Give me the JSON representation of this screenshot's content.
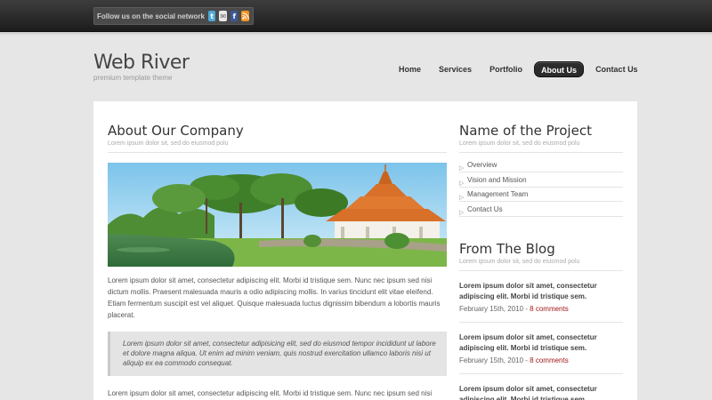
{
  "topbar": {
    "social_text": "Follow us on the social network",
    "icons": [
      "twitter-icon",
      "mail-icon",
      "facebook-icon",
      "rss-icon"
    ]
  },
  "logo": {
    "title": "Web River",
    "subtitle": "premium template theme"
  },
  "nav": {
    "items": [
      "Home",
      "Services",
      "Portfolio",
      "About Us",
      "Contact Us"
    ],
    "active": "About Us"
  },
  "main": {
    "title": "About Our Company",
    "subtitle": "Lorem ipsum dolor sit, sed do eiusmod polu",
    "paragraph1": "Lorem ipsum dolor sit amet, consectetur adipiscing elit. Morbi id tristique sem. Nunc nec ipsum sed nisi dictum mollis. Praesent malesuada mauris a odio adipiscing mollis. In varius tincidunt elit vitae eleifend. Etiam fermentum suscipit est vel aliquet. Quisque malesuada luctus dignissim bibendum a lobortis mauris placerat.",
    "quote": "Lorem ipsum dolor sit amet, consectetur adipisicing elit, sed do eiusmod tempor incididunt ut labore et dolore magna aliqua. Ut enim ad minim veniam, quis nostrud exercitation ullamco laboris nisi ut aliquip ex ea commodo consequat.",
    "paragraph2": "Lorem ipsum dolor sit amet, consectetur adipiscing elit. Morbi id tristique sem. Nunc nec ipsum sed nisi"
  },
  "sidebar": {
    "project_title": "Name of the Project",
    "project_subtitle": "Lorem ipsum dolor sit, sed do eiusmod polu",
    "menu": [
      "Overview",
      "Vision and Mission",
      "Management Team",
      "Contact Us"
    ],
    "blog_title": "From The Blog",
    "blog_subtitle": "Lorem ipsum dolor sit, sed do eiusmod polu",
    "posts": [
      {
        "title": "Lorem ipsum dolor sit amet, consectetur adipiscing elit. Morbi id tristique sem.",
        "date": "February 15th, 2010 - ",
        "comments": "8 comments"
      },
      {
        "title": "Lorem ipsum dolor sit amet, consectetur adipiscing elit. Morbi id tristique sem.",
        "date": "February 15th, 2010 - ",
        "comments": "8 comments"
      },
      {
        "title": "Lorem ipsum dolor sit amet, consectetur adipiscing elit. Morbi id tristique sem.",
        "date": "",
        "comments": ""
      }
    ]
  },
  "colors": {
    "background": "#e6e6e6",
    "topbar": "#2a2a2a",
    "accent_link": "#a01818",
    "nav_active": "#2c2c2c"
  }
}
